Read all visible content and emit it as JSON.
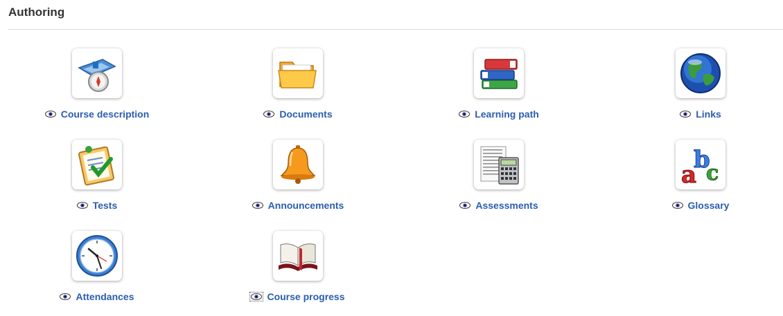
{
  "section": {
    "title": "Authoring"
  },
  "tools": [
    {
      "label": "Course description",
      "icon": "course-description-icon"
    },
    {
      "label": "Documents",
      "icon": "folder-icon"
    },
    {
      "label": "Learning path",
      "icon": "books-icon"
    },
    {
      "label": "Links",
      "icon": "globe-icon"
    },
    {
      "label": "Tests",
      "icon": "checklist-icon"
    },
    {
      "label": "Announcements",
      "icon": "bell-icon"
    },
    {
      "label": "Assessments",
      "icon": "calculator-icon"
    },
    {
      "label": "Glossary",
      "icon": "abc-icon"
    },
    {
      "label": "Attendances",
      "icon": "clock-icon"
    },
    {
      "label": "Course progress",
      "icon": "open-book-icon"
    }
  ],
  "visibility_icon": "eye-icon",
  "colors": {
    "link": "#2a5db0",
    "title": "#333333",
    "divider": "#d9d9d9"
  }
}
